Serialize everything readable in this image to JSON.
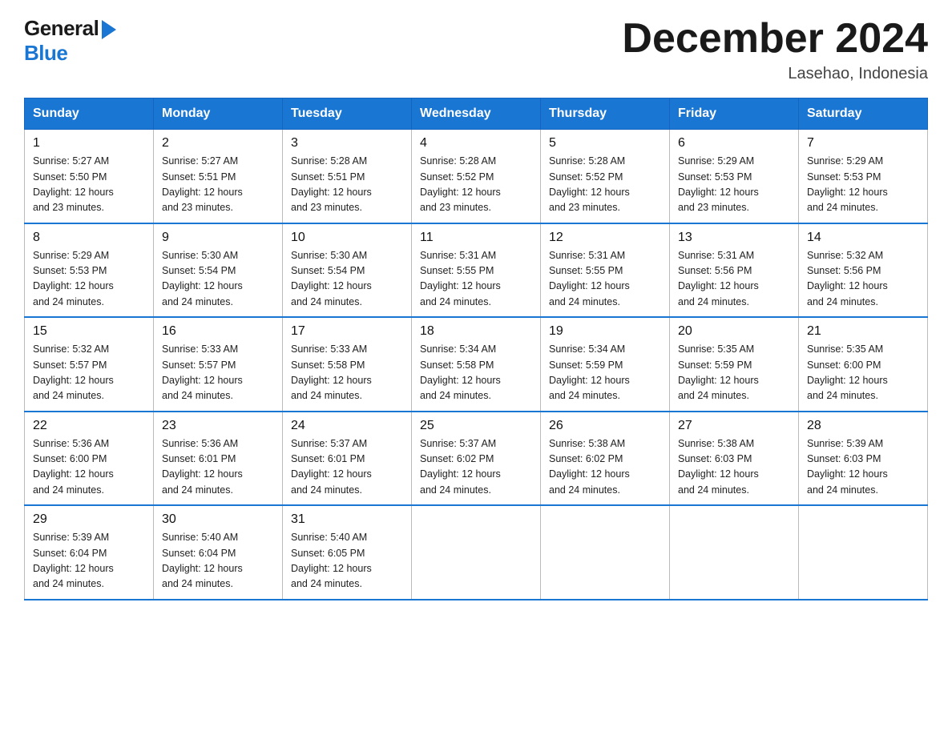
{
  "logo": {
    "general": "General",
    "blue": "Blue"
  },
  "title": "December 2024",
  "subtitle": "Lasehao, Indonesia",
  "headers": [
    "Sunday",
    "Monday",
    "Tuesday",
    "Wednesday",
    "Thursday",
    "Friday",
    "Saturday"
  ],
  "weeks": [
    [
      {
        "day": "1",
        "sunrise": "5:27 AM",
        "sunset": "5:50 PM",
        "daylight": "12 hours and 23 minutes."
      },
      {
        "day": "2",
        "sunrise": "5:27 AM",
        "sunset": "5:51 PM",
        "daylight": "12 hours and 23 minutes."
      },
      {
        "day": "3",
        "sunrise": "5:28 AM",
        "sunset": "5:51 PM",
        "daylight": "12 hours and 23 minutes."
      },
      {
        "day": "4",
        "sunrise": "5:28 AM",
        "sunset": "5:52 PM",
        "daylight": "12 hours and 23 minutes."
      },
      {
        "day": "5",
        "sunrise": "5:28 AM",
        "sunset": "5:52 PM",
        "daylight": "12 hours and 23 minutes."
      },
      {
        "day": "6",
        "sunrise": "5:29 AM",
        "sunset": "5:53 PM",
        "daylight": "12 hours and 23 minutes."
      },
      {
        "day": "7",
        "sunrise": "5:29 AM",
        "sunset": "5:53 PM",
        "daylight": "12 hours and 24 minutes."
      }
    ],
    [
      {
        "day": "8",
        "sunrise": "5:29 AM",
        "sunset": "5:53 PM",
        "daylight": "12 hours and 24 minutes."
      },
      {
        "day": "9",
        "sunrise": "5:30 AM",
        "sunset": "5:54 PM",
        "daylight": "12 hours and 24 minutes."
      },
      {
        "day": "10",
        "sunrise": "5:30 AM",
        "sunset": "5:54 PM",
        "daylight": "12 hours and 24 minutes."
      },
      {
        "day": "11",
        "sunrise": "5:31 AM",
        "sunset": "5:55 PM",
        "daylight": "12 hours and 24 minutes."
      },
      {
        "day": "12",
        "sunrise": "5:31 AM",
        "sunset": "5:55 PM",
        "daylight": "12 hours and 24 minutes."
      },
      {
        "day": "13",
        "sunrise": "5:31 AM",
        "sunset": "5:56 PM",
        "daylight": "12 hours and 24 minutes."
      },
      {
        "day": "14",
        "sunrise": "5:32 AM",
        "sunset": "5:56 PM",
        "daylight": "12 hours and 24 minutes."
      }
    ],
    [
      {
        "day": "15",
        "sunrise": "5:32 AM",
        "sunset": "5:57 PM",
        "daylight": "12 hours and 24 minutes."
      },
      {
        "day": "16",
        "sunrise": "5:33 AM",
        "sunset": "5:57 PM",
        "daylight": "12 hours and 24 minutes."
      },
      {
        "day": "17",
        "sunrise": "5:33 AM",
        "sunset": "5:58 PM",
        "daylight": "12 hours and 24 minutes."
      },
      {
        "day": "18",
        "sunrise": "5:34 AM",
        "sunset": "5:58 PM",
        "daylight": "12 hours and 24 minutes."
      },
      {
        "day": "19",
        "sunrise": "5:34 AM",
        "sunset": "5:59 PM",
        "daylight": "12 hours and 24 minutes."
      },
      {
        "day": "20",
        "sunrise": "5:35 AM",
        "sunset": "5:59 PM",
        "daylight": "12 hours and 24 minutes."
      },
      {
        "day": "21",
        "sunrise": "5:35 AM",
        "sunset": "6:00 PM",
        "daylight": "12 hours and 24 minutes."
      }
    ],
    [
      {
        "day": "22",
        "sunrise": "5:36 AM",
        "sunset": "6:00 PM",
        "daylight": "12 hours and 24 minutes."
      },
      {
        "day": "23",
        "sunrise": "5:36 AM",
        "sunset": "6:01 PM",
        "daylight": "12 hours and 24 minutes."
      },
      {
        "day": "24",
        "sunrise": "5:37 AM",
        "sunset": "6:01 PM",
        "daylight": "12 hours and 24 minutes."
      },
      {
        "day": "25",
        "sunrise": "5:37 AM",
        "sunset": "6:02 PM",
        "daylight": "12 hours and 24 minutes."
      },
      {
        "day": "26",
        "sunrise": "5:38 AM",
        "sunset": "6:02 PM",
        "daylight": "12 hours and 24 minutes."
      },
      {
        "day": "27",
        "sunrise": "5:38 AM",
        "sunset": "6:03 PM",
        "daylight": "12 hours and 24 minutes."
      },
      {
        "day": "28",
        "sunrise": "5:39 AM",
        "sunset": "6:03 PM",
        "daylight": "12 hours and 24 minutes."
      }
    ],
    [
      {
        "day": "29",
        "sunrise": "5:39 AM",
        "sunset": "6:04 PM",
        "daylight": "12 hours and 24 minutes."
      },
      {
        "day": "30",
        "sunrise": "5:40 AM",
        "sunset": "6:04 PM",
        "daylight": "12 hours and 24 minutes."
      },
      {
        "day": "31",
        "sunrise": "5:40 AM",
        "sunset": "6:05 PM",
        "daylight": "12 hours and 24 minutes."
      },
      null,
      null,
      null,
      null
    ]
  ],
  "labels": {
    "sunrise": "Sunrise:",
    "sunset": "Sunset:",
    "daylight": "Daylight:"
  }
}
